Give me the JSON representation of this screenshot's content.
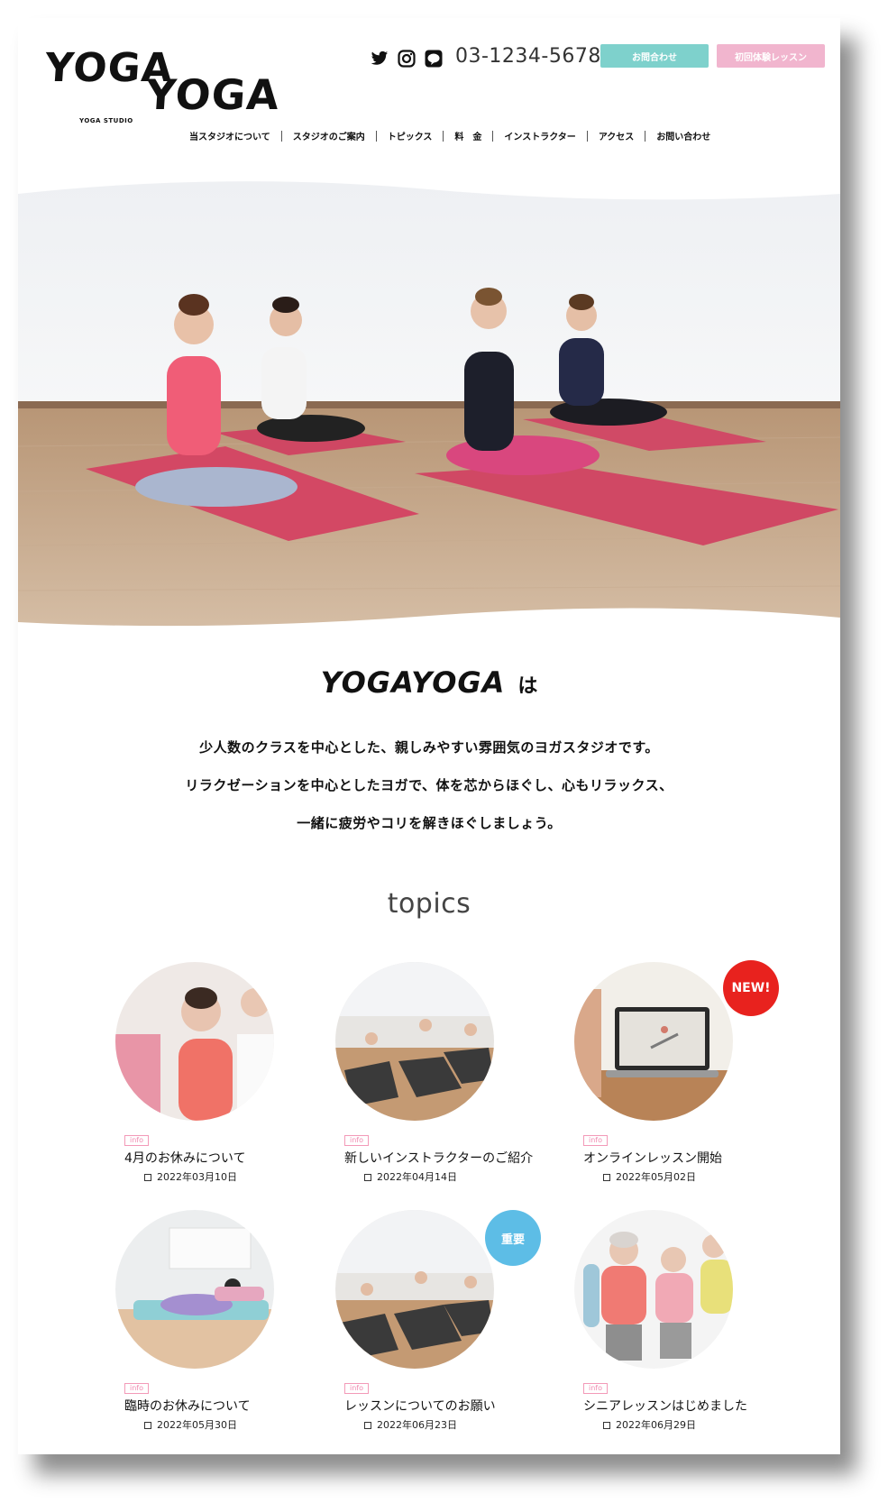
{
  "header": {
    "logo_word1": "YOGA",
    "logo_word2": "YOGA",
    "logo_sub": "YOGA STUDIO",
    "phone": "03-1234-5678",
    "contact_button": "お問合わせ",
    "trial_button": "初回体験レッスン",
    "social_icons": [
      "twitter-icon",
      "instagram-icon",
      "line-icon"
    ]
  },
  "nav": {
    "items": [
      {
        "label": "当スタジオについて"
      },
      {
        "label": "スタジオのご案内"
      },
      {
        "label": "トピックス"
      },
      {
        "label": "料　金"
      },
      {
        "label": "インストラクター"
      },
      {
        "label": "アクセス"
      },
      {
        "label": "お問い合わせ"
      }
    ]
  },
  "intro": {
    "brand": "YOGAYOGA",
    "particle": "は",
    "line1": "少人数のクラスを中心とした、親しみやすい雰囲気のヨガスタジオです。",
    "line2": "リラクゼーションを中心としたヨガで、体を芯からほぐし、心もリラックス、",
    "line3": "一緒に疲労やコリを解きほぐしましょう。"
  },
  "topics": {
    "title": "topics",
    "cards": [
      {
        "tag": "info",
        "title": "4月のお休みについて",
        "date": "2022年03月10日"
      },
      {
        "tag": "info",
        "title": "新しいインストラクターのご紹介",
        "date": "2022年04月14日"
      },
      {
        "tag": "info",
        "title": "オンラインレッスン開始",
        "date": "2022年05月02日"
      },
      {
        "tag": "info",
        "title": "臨時のお休みについて",
        "date": "2022年05月30日"
      },
      {
        "tag": "info",
        "title": "レッスンについてのお願い",
        "date": "2022年06月23日"
      },
      {
        "tag": "info",
        "title": "シニアレッスンはじめました",
        "date": "2022年06月29日"
      }
    ],
    "badge_new": "NEW!",
    "badge_important": "重要"
  },
  "colors": {
    "contact": "#7ed1cc",
    "trial": "#f1b5ce",
    "new_badge": "#e8221e",
    "important_badge": "#5dbde6",
    "tag": "#f08ab0"
  }
}
